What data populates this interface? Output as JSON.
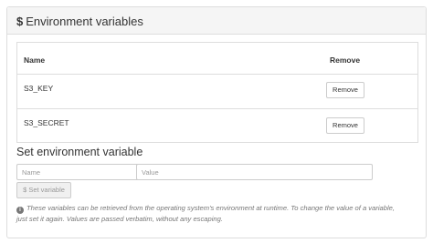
{
  "panel": {
    "title_symbol": "$",
    "title": "Environment variables"
  },
  "table": {
    "headers": {
      "name": "Name",
      "remove": "Remove"
    },
    "rows": [
      {
        "name": "S3_KEY",
        "action": "Remove"
      },
      {
        "name": "S3_SECRET",
        "action": "Remove"
      }
    ]
  },
  "form": {
    "title": "Set environment variable",
    "name_placeholder": "Name",
    "value_placeholder": "Value",
    "submit_label": "$ Set variable",
    "submit_disabled": true
  },
  "help": {
    "icon": "info-icon",
    "icon_glyph": "i",
    "text": "These variables can be retrieved from the operating system's environment at runtime. To change the value of a variable, just set it again. Values are passed verbatim, without any escaping."
  }
}
